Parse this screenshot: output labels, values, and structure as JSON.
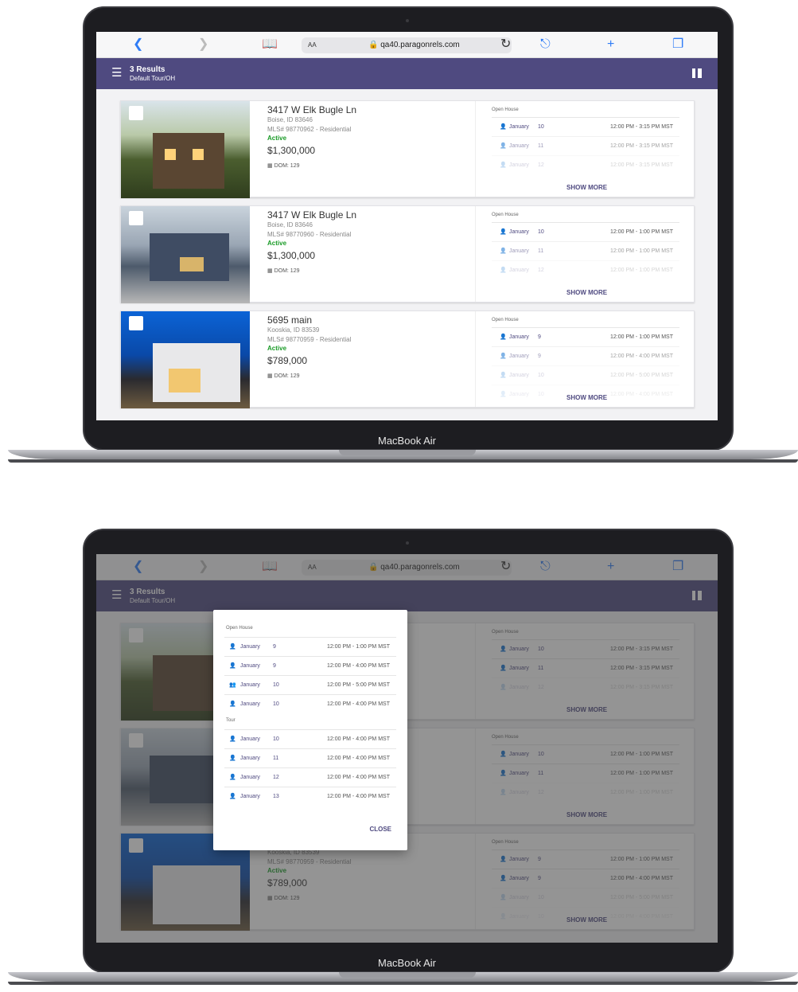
{
  "laptop_label": "MacBook Air",
  "browser": {
    "reader_icon": "book-icon",
    "text_size": "AA",
    "url": "qa40.paragonrels.com",
    "lock": "🔒"
  },
  "header": {
    "title": "3 Results",
    "subtitle": "Default Tour/OH"
  },
  "listings": [
    {
      "address": "3417 W Elk Bugle Ln",
      "city": "Boise, ID 83646",
      "mls": "MLS# 98770962 - Residential",
      "status": "Active",
      "price": "$1,300,000",
      "dom": "DOM: 129",
      "events_label": "Open House",
      "events": [
        {
          "month": "January",
          "day": "10",
          "time": "12:00 PM - 3:15 PM MST"
        },
        {
          "month": "January",
          "day": "11",
          "time": "12:00 PM - 3:15 PM MST"
        },
        {
          "month": "January",
          "day": "12",
          "time": "12:00 PM - 3:15 PM MST"
        }
      ],
      "show_more": "SHOW MORE"
    },
    {
      "address": "3417 W Elk Bugle Ln",
      "city": "Boise, ID 83646",
      "mls": "MLS# 98770960 - Residential",
      "status": "Active",
      "price": "$1,300,000",
      "dom": "DOM: 129",
      "events_label": "Open House",
      "events": [
        {
          "month": "January",
          "day": "10",
          "time": "12:00 PM - 1:00 PM MST"
        },
        {
          "month": "January",
          "day": "11",
          "time": "12:00 PM - 1:00 PM MST"
        },
        {
          "month": "January",
          "day": "12",
          "time": "12:00 PM - 1:00 PM MST"
        }
      ],
      "show_more": "SHOW MORE"
    },
    {
      "address": "5695 main",
      "city": "Kooskia, ID 83539",
      "mls": "MLS# 98770959 - Residential",
      "status": "Active",
      "price": "$789,000",
      "dom": "DOM: 129",
      "events_label": "Open House",
      "events": [
        {
          "month": "January",
          "day": "9",
          "time": "12:00 PM - 1:00 PM MST"
        },
        {
          "month": "January",
          "day": "9",
          "time": "12:00 PM - 4:00 PM MST"
        },
        {
          "month": "January",
          "day": "10",
          "time": "12:00 PM - 5:00 PM MST"
        },
        {
          "month": "January",
          "day": "10",
          "time": "12:00 PM - 4:00 PM MST"
        }
      ],
      "show_more": "SHOW MORE"
    }
  ],
  "modal": {
    "open_house_label": "Open House",
    "open_house": [
      {
        "month": "January",
        "day": "9",
        "time": "12:00 PM - 1:00 PM MST"
      },
      {
        "month": "January",
        "day": "9",
        "time": "12:00 PM - 4:00 PM MST"
      },
      {
        "month": "January",
        "day": "10",
        "time": "12:00 PM - 5:00 PM MST"
      },
      {
        "month": "January",
        "day": "10",
        "time": "12:00 PM - 4:00 PM MST"
      }
    ],
    "tour_label": "Tour",
    "tour": [
      {
        "month": "January",
        "day": "10",
        "time": "12:00 PM - 4:00 PM MST"
      },
      {
        "month": "January",
        "day": "11",
        "time": "12:00 PM - 4:00 PM MST"
      },
      {
        "month": "January",
        "day": "12",
        "time": "12:00 PM - 4:00 PM MST"
      },
      {
        "month": "January",
        "day": "13",
        "time": "12:00 PM - 4:00 PM MST"
      }
    ],
    "close_label": "CLOSE"
  },
  "colors": {
    "header": "#4f4a80",
    "active": "#1a9b27",
    "link": "#2f7cf6"
  }
}
